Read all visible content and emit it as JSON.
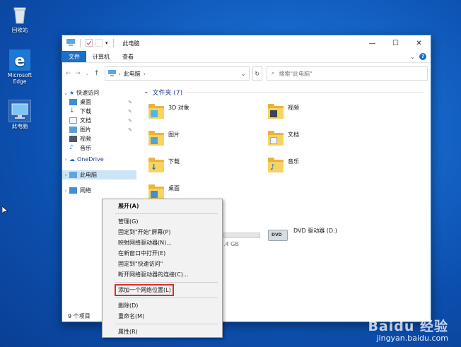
{
  "desktop": {
    "icons": [
      {
        "name": "recycle-bin",
        "label": "回收站"
      },
      {
        "name": "edge",
        "label": "Microsoft Edge"
      },
      {
        "name": "this-pc",
        "label": "此电脑"
      }
    ]
  },
  "window": {
    "title": "此电脑",
    "ribbon_tabs": [
      "文件",
      "计算机",
      "查看"
    ],
    "address": {
      "crumb": "此电脑"
    },
    "search": {
      "placeholder": "搜索\"此电脑\""
    },
    "status_text": "9 个项目"
  },
  "nav": {
    "quick_access": "快速访问",
    "items": [
      "桌面",
      "下载",
      "文档",
      "图片",
      "视频",
      "音乐"
    ],
    "onedrive": "OneDrive",
    "this_pc": "此电脑",
    "network": "网络"
  },
  "content": {
    "group_title": "文件夹 (7)",
    "folders": [
      "3D 对象",
      "视频",
      "图片",
      "文档",
      "下载",
      "音乐",
      "桌面"
    ],
    "drive_size": ".4 GB",
    "dvd_label": "DVD 驱动器 (D:)",
    "dvd_text": "DVD"
  },
  "context_menu": {
    "items": [
      "展开(A)",
      "管理(G)",
      "固定到\"开始\"屏幕(P)",
      "映射网络驱动器(N)...",
      "在新窗口中打开(E)",
      "固定到\"快速访问\"",
      "断开网络驱动器的连接(C)...",
      "添加一个网络位置(L)",
      "删除(D)",
      "重命名(M)",
      "属性(R)"
    ]
  },
  "watermark": {
    "brand": "Baidu 经验",
    "url": "jingyan.baidu.com"
  },
  "colors": {
    "accent": "#1a6fc8",
    "folder": "#f7d360",
    "highlight_border": "#e02a2a"
  }
}
